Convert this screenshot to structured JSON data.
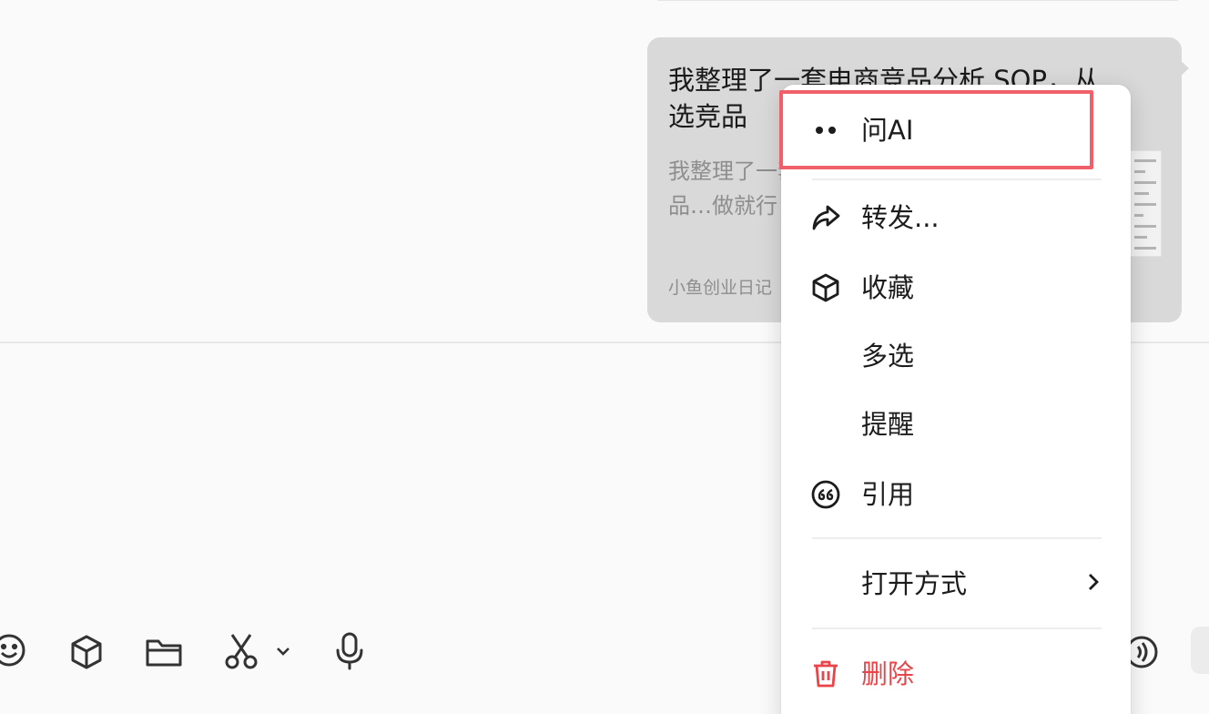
{
  "message_card": {
    "title": "我整理了一套电商竞品分析 SOP，从选竞品",
    "summary": "我整理了一套电商竞品分析 SOP，从选竞品…做就行",
    "source": "小鱼创业日记"
  },
  "context_menu": {
    "items": [
      {
        "label": "问AI",
        "icon": "ai-dots-icon"
      },
      {
        "label": "转发...",
        "icon": "forward-icon"
      },
      {
        "label": "收藏",
        "icon": "favorite-cube-icon"
      },
      {
        "label": "多选",
        "icon": ""
      },
      {
        "label": "提醒",
        "icon": ""
      },
      {
        "label": "引用",
        "icon": "quote-icon"
      },
      {
        "label": "打开方式",
        "icon": "chevron-right-icon"
      },
      {
        "label": "删除",
        "icon": "trash-icon"
      }
    ],
    "danger_color": "#e8454a",
    "highlight_color": "#f0606a"
  },
  "toolbar": {
    "icons": [
      "emoji-icon",
      "sticker-cube-icon",
      "folder-icon",
      "scissors-screenshot-icon",
      "chevron-down-icon",
      "microphone-icon",
      "voice-call-icon"
    ]
  }
}
